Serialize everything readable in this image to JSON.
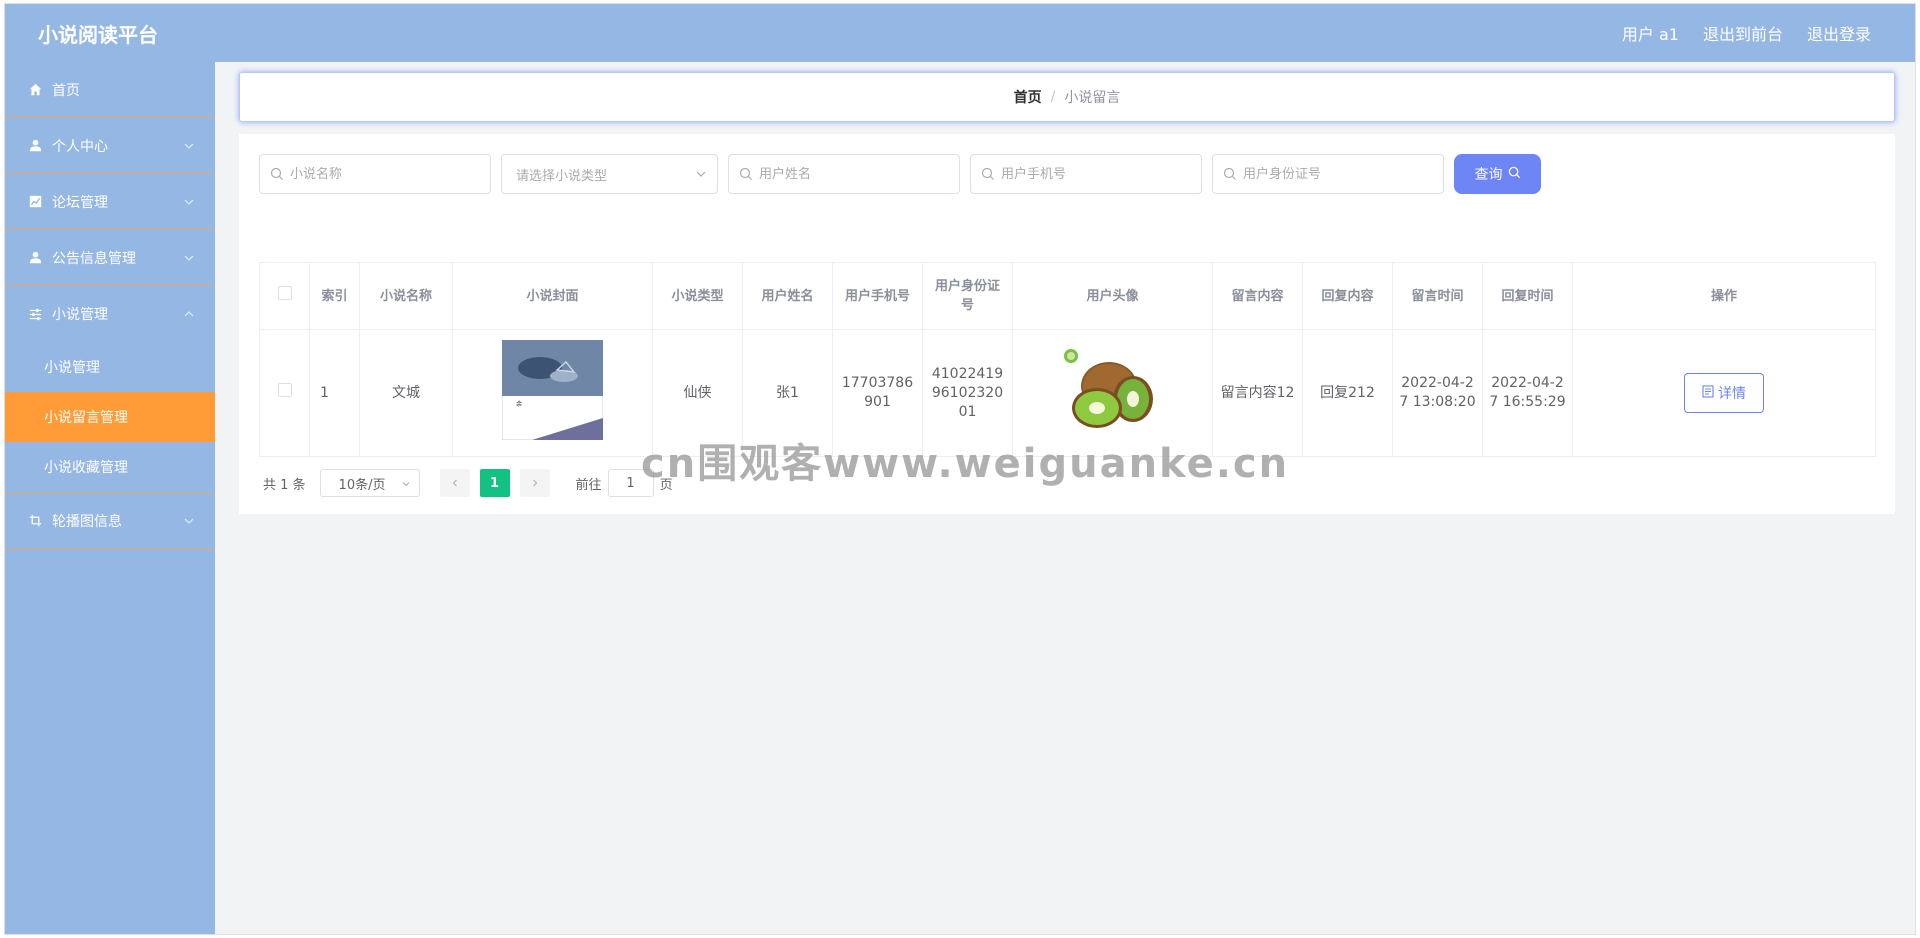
{
  "app": {
    "title": "小说阅读平台",
    "user_label": "用户 a1",
    "exit_front": "退出到前台",
    "logout": "退出登录"
  },
  "sidebar": {
    "items": [
      {
        "label": "首页",
        "icon": "home-icon"
      },
      {
        "label": "个人中心",
        "icon": "user-icon"
      },
      {
        "label": "论坛管理",
        "icon": "chart-icon"
      },
      {
        "label": "公告信息管理",
        "icon": "user-icon"
      },
      {
        "label": "小说管理",
        "icon": "sliders-icon"
      },
      {
        "label": "轮播图信息",
        "icon": "crop-icon"
      }
    ],
    "subitems": [
      {
        "label": "小说管理"
      },
      {
        "label": "小说留言管理"
      },
      {
        "label": "小说收藏管理"
      }
    ]
  },
  "breadcrumb": {
    "home": "首页",
    "separator": "/",
    "current": "小说留言"
  },
  "search": {
    "novel_name_placeholder": "小说名称",
    "novel_type_placeholder": "请选择小说类型",
    "user_name_placeholder": "用户姓名",
    "user_phone_placeholder": "用户手机号",
    "user_id_placeholder": "用户身份证号",
    "query_label": "查询"
  },
  "table": {
    "headers": [
      "索引",
      "小说名称",
      "小说封面",
      "小说类型",
      "用户姓名",
      "用户手机号",
      "用户身份证号",
      "用户头像",
      "留言内容",
      "回复内容",
      "留言时间",
      "回复时间",
      "操作"
    ],
    "rows": [
      {
        "index": "1",
        "novel_name": "文城",
        "novel_type": "仙侠",
        "user_name": "张1",
        "user_phone": "17703786901",
        "user_id": "410224199610232001",
        "message": "留言内容12",
        "reply": "回复212",
        "message_time": "2022-04-27 13:08:20",
        "reply_time": "2022-04-27 16:55:29",
        "action_label": "详情",
        "cover_text": "文城"
      }
    ]
  },
  "pagination": {
    "total": "共 1 条",
    "page_size": "10条/页",
    "current_page": "1",
    "goto_label": "前往",
    "goto_value": "1",
    "page_unit": "页"
  },
  "watermark": "cn围观客www.weiguanke.cn",
  "colors": {
    "header_bg": "#95b7e4",
    "active_menu": "#ff9c37",
    "primary": "#6d85f5",
    "pager_active": "#13c283"
  }
}
